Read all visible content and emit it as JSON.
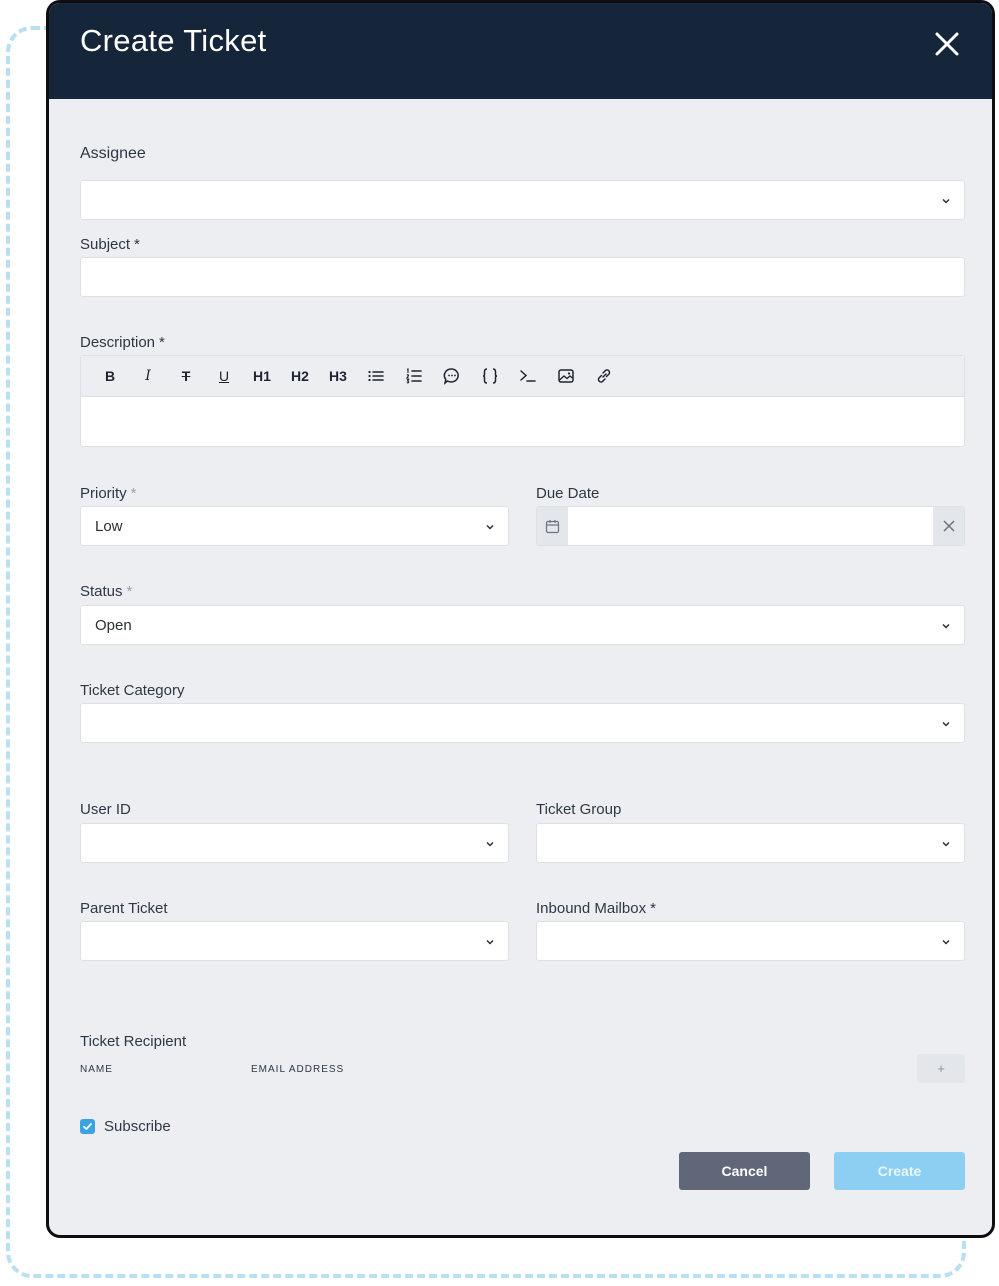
{
  "modal": {
    "title": "Create Ticket"
  },
  "fields": {
    "assignee": {
      "label": "Assignee",
      "value": ""
    },
    "subject": {
      "label": "Subject",
      "required": "*",
      "value": ""
    },
    "description": {
      "label": "Description",
      "required": "*"
    },
    "priority": {
      "label": "Priority",
      "required": "*",
      "value": "Low"
    },
    "due_date": {
      "label": "Due Date",
      "value": ""
    },
    "status": {
      "label": "Status",
      "required": "*",
      "value": "Open"
    },
    "ticket_category": {
      "label": "Ticket Category",
      "value": ""
    },
    "user_id": {
      "label": "User ID",
      "value": ""
    },
    "ticket_group": {
      "label": "Ticket Group",
      "value": ""
    },
    "parent_ticket": {
      "label": "Parent Ticket",
      "value": ""
    },
    "inbound_mailbox": {
      "label": "Inbound Mailbox",
      "required": "*",
      "value": ""
    }
  },
  "editor_toolbar": {
    "bold": "B",
    "italic": "I",
    "strike": "T",
    "underline": "U",
    "h1": "H1",
    "h2": "H2",
    "h3": "H3"
  },
  "recipients": {
    "label": "Ticket Recipient",
    "columns": [
      "NAME",
      "EMAIL ADDRESS"
    ],
    "add_label": "+"
  },
  "subscribe": {
    "label": "Subscribe",
    "checked": true
  },
  "buttons": {
    "cancel": "Cancel",
    "create": "Create"
  },
  "colors": {
    "header": "#16263a",
    "accent": "#3aa3e3",
    "cancel": "#5f6778",
    "create_disabled": "#8ccff3"
  }
}
